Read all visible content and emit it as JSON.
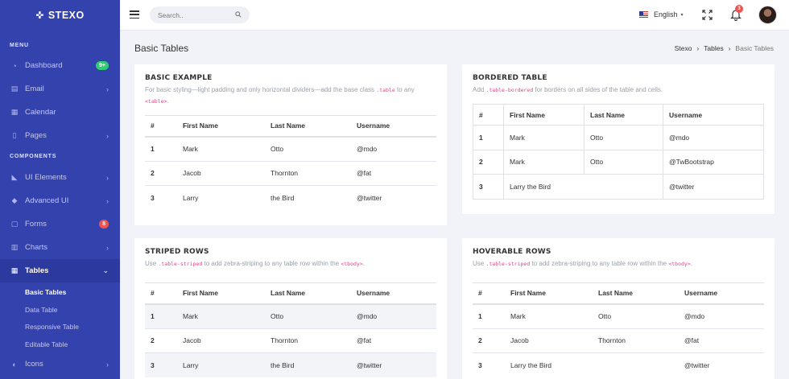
{
  "brand": {
    "name": "STEXO",
    "logo_icon": "plus-cross-icon"
  },
  "sidebar": {
    "section_menu": "MENU",
    "section_components": "COMPONENTS",
    "menu": [
      {
        "label": "Dashboard",
        "icon": "dashboard-icon",
        "badge": "9+",
        "badge_color": "#2ecc71"
      },
      {
        "label": "Email",
        "icon": "email-icon"
      },
      {
        "label": "Calendar",
        "icon": "calendar-icon"
      },
      {
        "label": "Pages",
        "icon": "pages-icon"
      }
    ],
    "components": [
      {
        "label": "UI Elements",
        "icon": "ui-elements-icon"
      },
      {
        "label": "Advanced UI",
        "icon": "advanced-ui-icon"
      },
      {
        "label": "Forms",
        "icon": "forms-icon",
        "badge": "8",
        "badge_color": "#ef5350"
      },
      {
        "label": "Charts",
        "icon": "charts-icon"
      },
      {
        "label": "Tables",
        "icon": "tables-icon",
        "active": true
      }
    ],
    "tables_sub": [
      "Basic Tables",
      "Data Table",
      "Responsive Table",
      "Editable Table"
    ],
    "after": [
      {
        "label": "Icons",
        "icon": "icons-icon"
      }
    ]
  },
  "topbar": {
    "search_placeholder": "Search..",
    "language": "English",
    "notifications_count": "3"
  },
  "page": {
    "title": "Basic Tables",
    "breadcrumb": [
      "Stexo",
      "Tables",
      "Basic Tables"
    ]
  },
  "cards": {
    "basic": {
      "title": "BASIC EXAMPLE",
      "desc_pre": "For basic styling—light padding and only horizontal dividers—add the base class ",
      "desc_code1": ".table",
      "desc_mid": " to any ",
      "desc_code2": "<table>",
      "desc_post": "."
    },
    "bordered": {
      "title": "BORDERED TABLE",
      "desc_pre": "Add ",
      "desc_code1": ".table-bordered",
      "desc_post": " for borders on all sides of the table and cells."
    },
    "striped": {
      "title": "STRIPED ROWS",
      "desc_pre": "Use ",
      "desc_code1": ".table-striped",
      "desc_mid": " to add zebra-striping to any table row within the ",
      "desc_code2": "<tbody>",
      "desc_post": "."
    },
    "hoverable": {
      "title": "HOVERABLE ROWS",
      "desc_pre": "Use ",
      "desc_code1": ".table-striped",
      "desc_mid": " to add zebra-striping to any table row within the ",
      "desc_code2": "<tbody>",
      "desc_post": "."
    }
  },
  "table": {
    "headers": [
      "#",
      "First Name",
      "Last Name",
      "Username"
    ],
    "rows": [
      [
        "1",
        "Mark",
        "Otto",
        "@mdo"
      ],
      [
        "2",
        "Jacob",
        "Thornton",
        "@fat"
      ],
      [
        "3",
        "Larry",
        "the Bird",
        "@twitter"
      ]
    ]
  },
  "bordered_table": {
    "headers": [
      "#",
      "First Name",
      "Last Name",
      "Username"
    ],
    "rows": [
      [
        "1",
        "Mark",
        "Otto",
        "@mdo"
      ],
      [
        "2",
        "Mark",
        "Otto",
        "@TwBootstrap"
      ],
      [
        "3",
        "Larry the Bird",
        "",
        "@twitter"
      ]
    ]
  },
  "hover_table": {
    "headers": [
      "#",
      "First Name",
      "Last Name",
      "Username"
    ],
    "rows": [
      [
        "1",
        "Mark",
        "Otto",
        "@mdo"
      ],
      [
        "2",
        "Jacob",
        "Thornton",
        "@fat"
      ],
      [
        "3",
        "Larry the Bird",
        "",
        "@twitter"
      ]
    ]
  },
  "colors": {
    "sidebar": "#3442ad",
    "accent_code": "#e83e8c",
    "badge_green": "#2ecc71",
    "badge_red": "#ef5350"
  }
}
